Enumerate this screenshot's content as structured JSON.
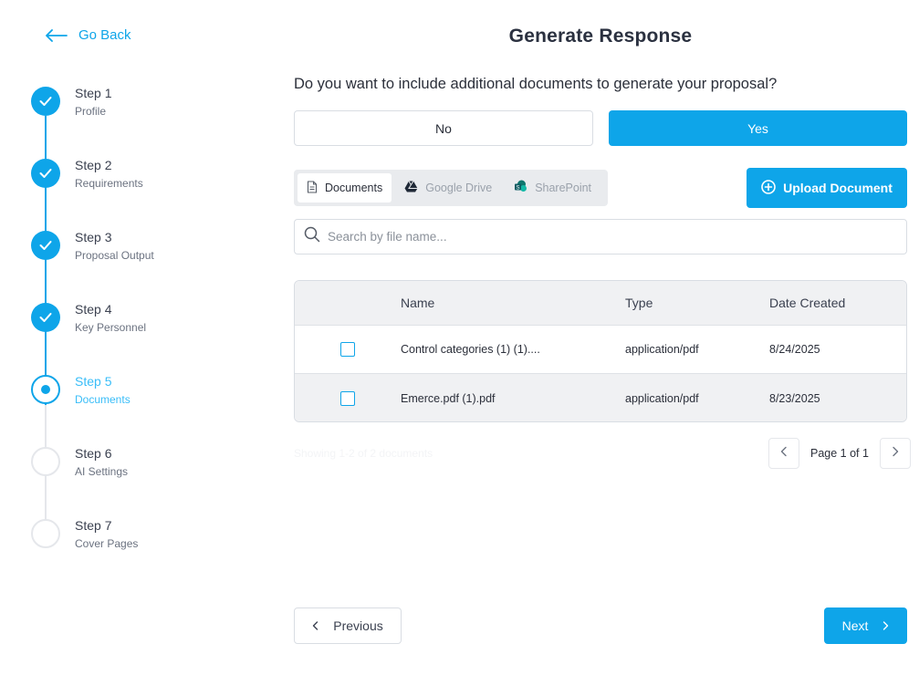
{
  "nav": {
    "back_label": "Go Back"
  },
  "page": {
    "title": "Generate Response"
  },
  "steps": [
    {
      "title": "Step 1",
      "subtitle": "Profile",
      "status": "complete"
    },
    {
      "title": "Step 2",
      "subtitle": "Requirements",
      "status": "complete"
    },
    {
      "title": "Step 3",
      "subtitle": "Proposal Output",
      "status": "complete"
    },
    {
      "title": "Step 4",
      "subtitle": "Key Personnel",
      "status": "complete"
    },
    {
      "title": "Step 5",
      "subtitle": "Documents",
      "status": "current"
    },
    {
      "title": "Step 6",
      "subtitle": "AI Settings",
      "status": "upcoming"
    },
    {
      "title": "Step 7",
      "subtitle": "Cover Pages",
      "status": "upcoming"
    }
  ],
  "question": "Do you want to include additional documents to generate your proposal?",
  "choices": {
    "no": "No",
    "yes": "Yes",
    "selected": "yes"
  },
  "sources": {
    "tabs": [
      {
        "label": "Documents",
        "icon": "file-icon",
        "active": true
      },
      {
        "label": "Google Drive",
        "icon": "google-drive-icon",
        "active": false
      },
      {
        "label": "SharePoint",
        "icon": "sharepoint-icon",
        "active": false
      }
    ]
  },
  "upload": {
    "label": "Upload Document"
  },
  "search": {
    "placeholder": "Search by file name...",
    "value": ""
  },
  "table": {
    "columns": [
      "Name",
      "Type",
      "Date Created"
    ],
    "rows": [
      {
        "name": "Control categories (1) (1)....",
        "type": "application/pdf",
        "date": "8/24/2025",
        "checked": false
      },
      {
        "name": "Emerce.pdf (1).pdf",
        "type": "application/pdf",
        "date": "8/23/2025",
        "checked": false
      }
    ]
  },
  "pagination": {
    "summary": "Showing 1-2 of 2 documents",
    "page_label": "Page 1 of 1"
  },
  "footer": {
    "previous_label": "Previous",
    "next_label": "Next"
  },
  "colors": {
    "accent": "#0ea5e9",
    "border": "#d9dde3",
    "row_alt": "#f0f1f3"
  }
}
